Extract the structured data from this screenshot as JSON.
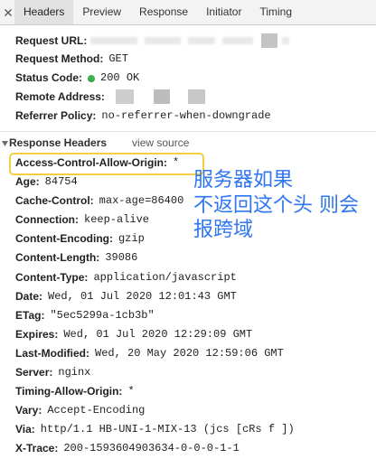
{
  "toolbar": {
    "close_icon": "close-icon",
    "tabs": [
      {
        "label": "Headers",
        "selected": true
      },
      {
        "label": "Preview",
        "selected": false
      },
      {
        "label": "Response",
        "selected": false
      },
      {
        "label": "Initiator",
        "selected": false
      },
      {
        "label": "Timing",
        "selected": false
      }
    ]
  },
  "general": {
    "request_url": {
      "name": "Request URL:"
    },
    "request_method": {
      "name": "Request Method:",
      "value": "GET"
    },
    "status_code": {
      "name": "Status Code:",
      "icon": "status-ok-dot-icon",
      "value": "200 OK"
    },
    "remote_address": {
      "name": "Remote Address:"
    },
    "referrer_policy": {
      "name": "Referrer Policy:",
      "value": "no-referrer-when-downgrade"
    }
  },
  "response_headers": {
    "toggle_icon": "triangle-down-icon",
    "title": "Response Headers",
    "view_source_label": "view source",
    "rows": [
      {
        "name": "Access-Control-Allow-Origin:",
        "value": "*"
      },
      {
        "name": "Age:",
        "value": "84754"
      },
      {
        "name": "Cache-Control:",
        "value": "max-age=86400"
      },
      {
        "name": "Connection:",
        "value": "keep-alive"
      },
      {
        "name": "Content-Encoding:",
        "value": "gzip"
      },
      {
        "name": "Content-Length:",
        "value": "39086"
      },
      {
        "name": "Content-Type:",
        "value": "application/javascript"
      },
      {
        "name": "Date:",
        "value": "Wed, 01 Jul 2020 12:01:43 GMT"
      },
      {
        "name": "ETag:",
        "value": "\"5ec5299a-1cb3b\""
      },
      {
        "name": "Expires:",
        "value": "Wed, 01 Jul 2020 12:29:09 GMT"
      },
      {
        "name": "Last-Modified:",
        "value": "Wed, 20 May 2020 12:59:06 GMT"
      },
      {
        "name": "Server:",
        "value": "nginx"
      },
      {
        "name": "Timing-Allow-Origin:",
        "value": "*"
      },
      {
        "name": "Vary:",
        "value": "Accept-Encoding"
      },
      {
        "name": "Via:",
        "value": "http/1.1 HB-UNI-1-MIX-13 (jcs [cRs f ])"
      },
      {
        "name": "X-Trace:",
        "value": "200-1593604903634-0-0-0-1-1"
      }
    ]
  },
  "annotation": {
    "lines": [
      "服务器如果",
      "不返回这个头 则会",
      "报跨域"
    ]
  },
  "colors": {
    "status_ok": "#3cb34f",
    "highlight_border": "#f2cf45",
    "annotation_text": "#2f76f1",
    "selected_tab_bg": "#e1e1e1"
  }
}
